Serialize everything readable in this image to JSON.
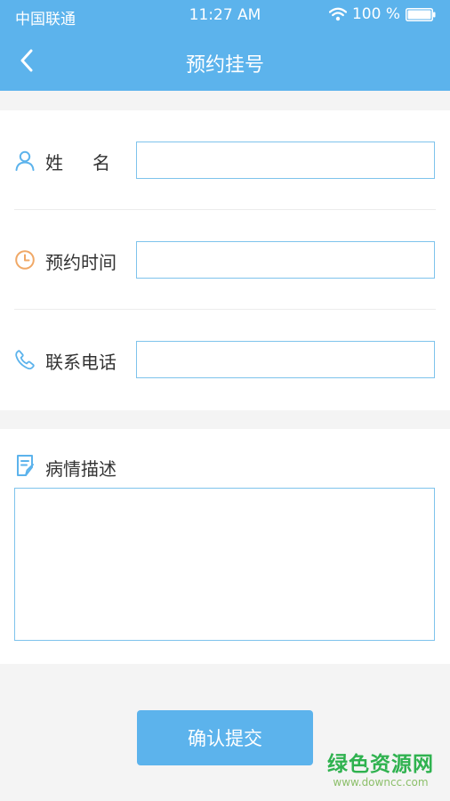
{
  "status_bar": {
    "carrier": "中国联通",
    "time": "11:27 AM",
    "battery": "100 %"
  },
  "nav": {
    "title": "预约挂号",
    "back_icon": "chevron-left-icon"
  },
  "form": {
    "name_label": "姓名",
    "time_label": "预约时间",
    "phone_label": "联系电话",
    "name_value": "",
    "time_value": "",
    "phone_value": ""
  },
  "description": {
    "label": "病情描述",
    "value": ""
  },
  "submit": {
    "label": "确认提交"
  },
  "watermark": {
    "name": "绿色资源网",
    "url": "www.downcc.com"
  },
  "icons": [
    "user-icon",
    "clock-icon",
    "phone-icon",
    "document-edit-icon",
    "wifi-icon",
    "battery-icon"
  ],
  "colors": {
    "primary": "#5cb3ec",
    "input_border": "#7ec3ec",
    "user_icon": "#5cb3ec",
    "clock_icon": "#f0a866",
    "phone_icon": "#5cb3ec",
    "background": "#f4f4f4",
    "watermark": "#2fb24f"
  }
}
